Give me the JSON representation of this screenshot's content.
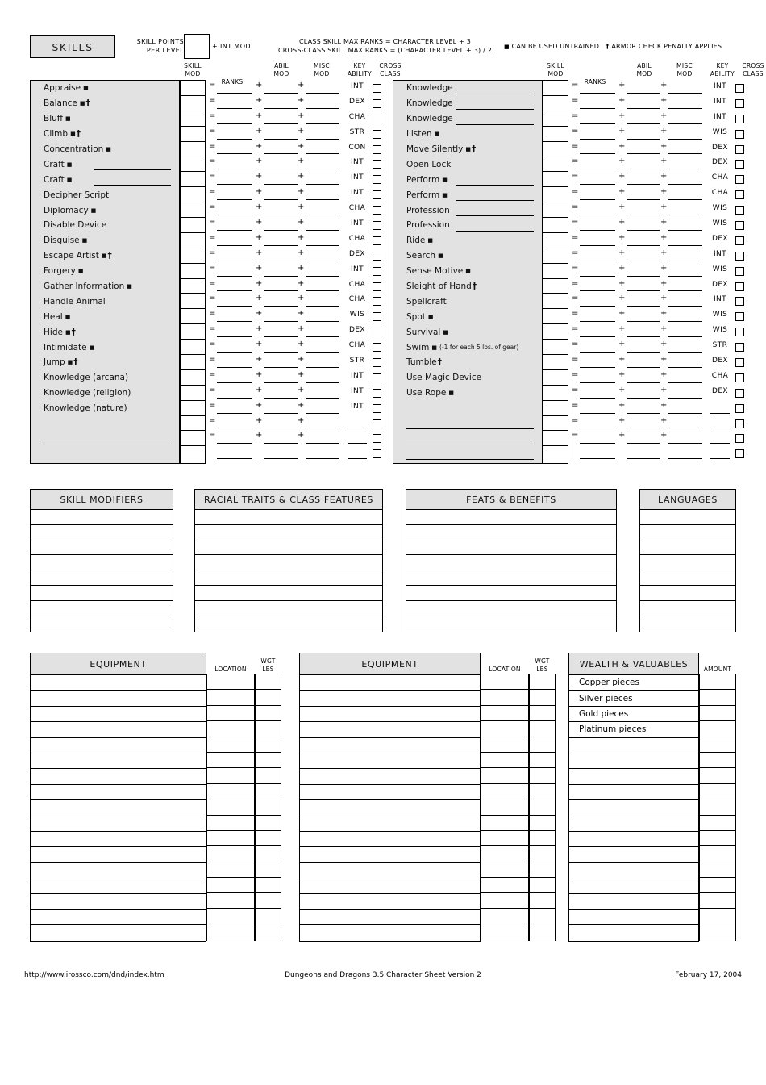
{
  "header": {
    "title": "SKILLS",
    "skill_points_label_line1": "SKILL POINTS",
    "skill_points_label_line2": "PER LEVEL",
    "skill_points_value": "",
    "int_mod_label": "+ INT MOD",
    "max_ranks_line1": "CLASS SKILL MAX RANKS = CHARACTER LEVEL + 3",
    "max_ranks_line2": "CROSS-CLASS SKILL MAX RANKS = (CHARACTER LEVEL + 3) / 2",
    "legend_untrained": "CAN BE USED UNTRAINED",
    "legend_armor": "ARMOR CHECK PENALTY APPLIES"
  },
  "skill_columns": {
    "skill_mod": "SKILL\nMOD",
    "skill_mod_l1": "SKILL",
    "skill_mod_l2": "MOD",
    "ranks": "RANKS",
    "abil_mod_l1": "ABIL",
    "abil_mod_l2": "MOD",
    "misc_mod_l1": "MISC",
    "misc_mod_l2": "MOD",
    "key_ability_l1": "KEY",
    "key_ability_l2": "ABILITY",
    "cross_class_l1": "CROSS",
    "cross_class_l2": "CLASS",
    "equals": "=",
    "plus": "+"
  },
  "skills_left": [
    {
      "name": "Appraise",
      "untrained": true,
      "armor": false,
      "ability": "INT",
      "blank": false
    },
    {
      "name": "Balance",
      "untrained": true,
      "armor": true,
      "ability": "DEX",
      "blank": false
    },
    {
      "name": "Bluff",
      "untrained": true,
      "armor": false,
      "ability": "CHA",
      "blank": false
    },
    {
      "name": "Climb",
      "untrained": true,
      "armor": true,
      "ability": "STR",
      "blank": false
    },
    {
      "name": "Concentration",
      "untrained": true,
      "armor": false,
      "ability": "CON",
      "blank": false
    },
    {
      "name": "Craft",
      "untrained": true,
      "armor": false,
      "ability": "INT",
      "blank": false,
      "fill_line": true
    },
    {
      "name": "Craft",
      "untrained": true,
      "armor": false,
      "ability": "INT",
      "blank": false,
      "fill_line": true
    },
    {
      "name": "Decipher Script",
      "untrained": false,
      "armor": false,
      "ability": "INT",
      "blank": false
    },
    {
      "name": "Diplomacy",
      "untrained": true,
      "armor": false,
      "ability": "CHA",
      "blank": false
    },
    {
      "name": "Disable Device",
      "untrained": false,
      "armor": false,
      "ability": "INT",
      "blank": false
    },
    {
      "name": "Disguise",
      "untrained": true,
      "armor": false,
      "ability": "CHA",
      "blank": false
    },
    {
      "name": "Escape Artist",
      "untrained": true,
      "armor": true,
      "ability": "DEX",
      "blank": false
    },
    {
      "name": "Forgery",
      "untrained": true,
      "armor": false,
      "ability": "INT",
      "blank": false
    },
    {
      "name": "Gather Information",
      "untrained": true,
      "armor": false,
      "ability": "CHA",
      "blank": false
    },
    {
      "name": "Handle Animal",
      "untrained": false,
      "armor": false,
      "ability": "CHA",
      "blank": false
    },
    {
      "name": "Heal",
      "untrained": true,
      "armor": false,
      "ability": "WIS",
      "blank": false
    },
    {
      "name": "Hide",
      "untrained": true,
      "armor": true,
      "ability": "DEX",
      "blank": false
    },
    {
      "name": "Intimidate",
      "untrained": true,
      "armor": false,
      "ability": "CHA",
      "blank": false
    },
    {
      "name": "Jump",
      "untrained": true,
      "armor": true,
      "ability": "STR",
      "blank": false
    },
    {
      "name": "Knowledge (arcana)",
      "untrained": false,
      "armor": false,
      "ability": "INT",
      "blank": false
    },
    {
      "name": "Knowledge (religion)",
      "untrained": false,
      "armor": false,
      "ability": "INT",
      "blank": false
    },
    {
      "name": "Knowledge (nature)",
      "untrained": false,
      "armor": false,
      "ability": "INT",
      "blank": false
    },
    {
      "name": "",
      "untrained": false,
      "armor": false,
      "ability": "",
      "blank": true
    },
    {
      "name": "",
      "untrained": false,
      "armor": false,
      "ability": "",
      "blank": true,
      "write_line": true
    },
    {
      "name": "",
      "untrained": false,
      "armor": false,
      "ability": "",
      "blank": true
    }
  ],
  "skills_right": [
    {
      "name": "Knowledge",
      "untrained": false,
      "armor": false,
      "ability": "INT",
      "blank": false,
      "fill_line": true
    },
    {
      "name": "Knowledge",
      "untrained": false,
      "armor": false,
      "ability": "INT",
      "blank": false,
      "fill_line": true
    },
    {
      "name": "Knowledge",
      "untrained": false,
      "armor": false,
      "ability": "INT",
      "blank": false,
      "fill_line": true
    },
    {
      "name": "Listen",
      "untrained": true,
      "armor": false,
      "ability": "WIS",
      "blank": false
    },
    {
      "name": "Move Silently",
      "untrained": true,
      "armor": true,
      "ability": "DEX",
      "blank": false
    },
    {
      "name": "Open Lock",
      "untrained": false,
      "armor": false,
      "ability": "DEX",
      "blank": false
    },
    {
      "name": "Perform",
      "untrained": true,
      "armor": false,
      "ability": "CHA",
      "blank": false,
      "fill_line": true
    },
    {
      "name": "Perform",
      "untrained": true,
      "armor": false,
      "ability": "CHA",
      "blank": false,
      "fill_line": true
    },
    {
      "name": "Profession",
      "untrained": false,
      "armor": false,
      "ability": "WIS",
      "blank": false,
      "fill_line": true
    },
    {
      "name": "Profession",
      "untrained": false,
      "armor": false,
      "ability": "WIS",
      "blank": false,
      "fill_line": true
    },
    {
      "name": "Ride",
      "untrained": true,
      "armor": false,
      "ability": "DEX",
      "blank": false
    },
    {
      "name": "Search",
      "untrained": true,
      "armor": false,
      "ability": "INT",
      "blank": false
    },
    {
      "name": "Sense Motive",
      "untrained": true,
      "armor": false,
      "ability": "WIS",
      "blank": false
    },
    {
      "name": "Sleight of Hand",
      "untrained": false,
      "armor": true,
      "ability": "DEX",
      "blank": false
    },
    {
      "name": "Spellcraft",
      "untrained": false,
      "armor": false,
      "ability": "INT",
      "blank": false
    },
    {
      "name": "Spot",
      "untrained": true,
      "armor": false,
      "ability": "WIS",
      "blank": false
    },
    {
      "name": "Survival",
      "untrained": true,
      "armor": false,
      "ability": "WIS",
      "blank": false
    },
    {
      "name": "Swim",
      "untrained": true,
      "armor": false,
      "ability": "STR",
      "blank": false,
      "note": "(-1 for each 5 lbs. of gear)"
    },
    {
      "name": "Tumble",
      "untrained": false,
      "armor": true,
      "ability": "DEX",
      "blank": false
    },
    {
      "name": "Use Magic Device",
      "untrained": false,
      "armor": false,
      "ability": "CHA",
      "blank": false
    },
    {
      "name": "Use Rope",
      "untrained": true,
      "armor": false,
      "ability": "DEX",
      "blank": false
    },
    {
      "name": "",
      "untrained": false,
      "armor": false,
      "ability": "",
      "blank": true
    },
    {
      "name": "",
      "untrained": false,
      "armor": false,
      "ability": "",
      "blank": true,
      "write_line": true
    },
    {
      "name": "",
      "untrained": false,
      "armor": false,
      "ability": "",
      "blank": true,
      "write_line": true
    },
    {
      "name": "",
      "untrained": false,
      "armor": false,
      "ability": "",
      "blank": true,
      "write_line": true
    }
  ],
  "mid_panels": [
    {
      "title": "SKILL MODIFIERS",
      "rows": [
        "",
        "",
        "",
        "",
        "",
        "",
        "",
        ""
      ]
    },
    {
      "title": "RACIAL TRAITS & CLASS FEATURES",
      "rows": [
        "",
        "",
        "",
        "",
        "",
        "",
        "",
        ""
      ]
    },
    {
      "title": "FEATS & BENEFITS",
      "rows": [
        "",
        "",
        "",
        "",
        "",
        "",
        "",
        ""
      ]
    },
    {
      "title": "LANGUAGES",
      "rows": [
        "",
        "",
        "",
        "",
        "",
        "",
        "",
        ""
      ]
    }
  ],
  "equipment_left": {
    "title": "EQUIPMENT",
    "location_label": "LOCATION",
    "wgt_label_l1": "WGT",
    "wgt_label_l2": "LBS",
    "rows": [
      "",
      "",
      "",
      "",
      "",
      "",
      "",
      "",
      "",
      "",
      "",
      "",
      "",
      "",
      "",
      "",
      ""
    ]
  },
  "equipment_right": {
    "title": "EQUIPMENT",
    "location_label": "LOCATION",
    "wgt_label_l1": "WGT",
    "wgt_label_l2": "LBS",
    "rows": [
      "",
      "",
      "",
      "",
      "",
      "",
      "",
      "",
      "",
      "",
      "",
      "",
      "",
      "",
      "",
      "",
      ""
    ]
  },
  "wealth": {
    "title": "WEALTH & VALUABLES",
    "amount_label": "AMOUNT",
    "rows": [
      "Copper pieces",
      "Silver pieces",
      "Gold pieces",
      "Platinum pieces",
      "",
      "",
      "",
      "",
      "",
      "",
      "",
      "",
      "",
      "",
      "",
      "",
      ""
    ]
  },
  "footer": {
    "url": "http://www.irossco.com/dnd/index.htm",
    "center": "Dungeons and Dragons 3.5 Character Sheet Version 2",
    "date": "February 17, 2004"
  },
  "colors": {
    "panel_header_gray": "#e2e2e2",
    "skill_name_gray": "#e2e2e2",
    "ink": "#000000",
    "page": "#ffffff"
  }
}
